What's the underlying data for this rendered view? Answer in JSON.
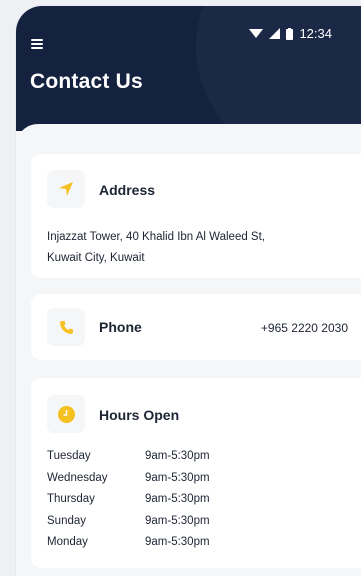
{
  "status_bar": {
    "time": "12:34"
  },
  "header": {
    "title": "Contact Us"
  },
  "address": {
    "title": "Address",
    "line1": "Injazzat Tower, 40 Khalid Ibn Al Waleed St,",
    "line2": "Kuwait City, Kuwait"
  },
  "phone": {
    "title": "Phone",
    "number": "+965 2220 2030"
  },
  "hours": {
    "title": "Hours Open",
    "rows": [
      {
        "day": "Tuesday",
        "time": "9am-5:30pm"
      },
      {
        "day": "Wednesday",
        "time": "9am-5:30pm"
      },
      {
        "day": "Thursday",
        "time": "9am-5:30pm"
      },
      {
        "day": "Sunday",
        "time": "9am-5:30pm"
      },
      {
        "day": "Monday",
        "time": "9am-5:30pm"
      }
    ]
  },
  "colors": {
    "header_bg": "#15223f",
    "accent": "#f5c022",
    "page_bg": "#f5f6f8"
  },
  "icons": [
    "menu-icon",
    "wifi-icon",
    "signal-icon",
    "battery-icon",
    "navigation-arrow-icon",
    "phone-icon",
    "clock-icon"
  ]
}
